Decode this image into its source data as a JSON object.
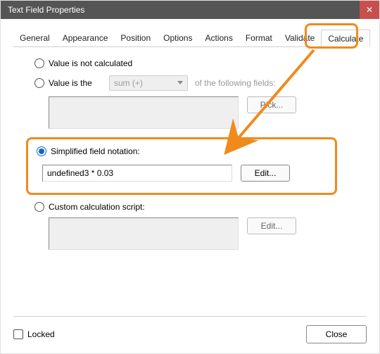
{
  "window": {
    "title": "Text Field Properties"
  },
  "tabs": {
    "items": [
      "General",
      "Appearance",
      "Position",
      "Options",
      "Actions",
      "Format",
      "Validate",
      "Calculate"
    ],
    "active": "Calculate"
  },
  "calc": {
    "opt_none": "Value is not calculated",
    "opt_valueis_prefix": "Value is the",
    "opt_valueis_suffix": "of the following fields:",
    "combo_value": "sum (+)",
    "pick_btn": "Pick...",
    "opt_sfn": "Simplified field notation:",
    "sfn_expr": "undefined3 * 0.03",
    "edit_btn": "Edit...",
    "opt_script": "Custom calculation script:",
    "edit_btn2": "Edit..."
  },
  "footer": {
    "locked": "Locked",
    "close": "Close"
  }
}
